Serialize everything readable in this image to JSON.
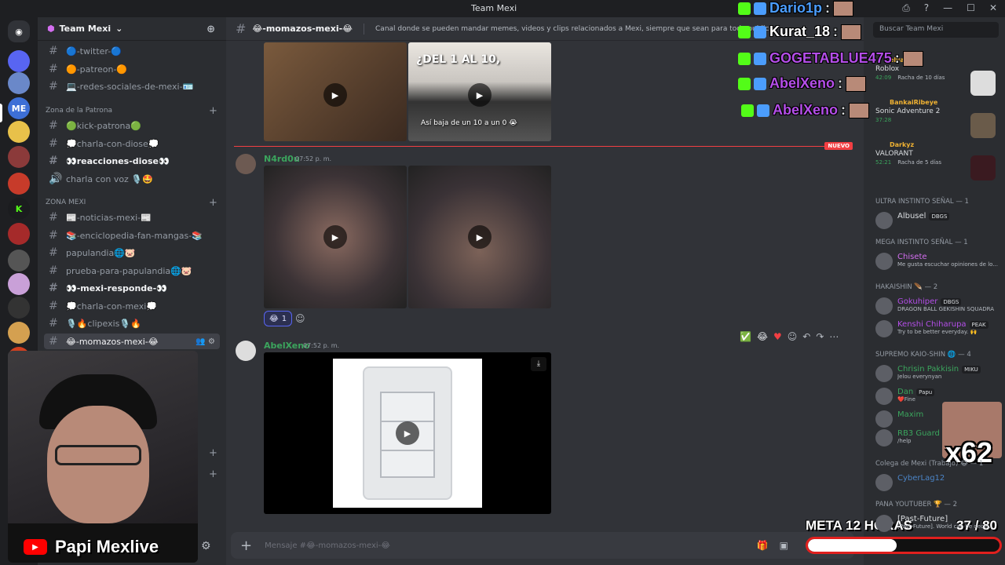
{
  "window": {
    "title": "Team Mexi",
    "controls": [
      "—",
      "☐",
      "✕"
    ]
  },
  "servers": [
    {
      "label": "",
      "color": "#5865f2"
    },
    {
      "label": "",
      "color": "#6a88c9"
    },
    {
      "label": "ME",
      "color": "#3d6fd6"
    },
    {
      "label": "",
      "color": "#e8c14a"
    },
    {
      "label": "",
      "color": "#8b3a3a"
    },
    {
      "label": "",
      "color": "#c73b2a"
    },
    {
      "label": "K",
      "color": "#1b1c1f"
    },
    {
      "label": "",
      "color": "#a52a2a"
    },
    {
      "label": "",
      "color": "#555"
    },
    {
      "label": "",
      "color": "#c9a0d8"
    },
    {
      "label": "",
      "color": "#333"
    },
    {
      "label": "",
      "color": "#d4a050"
    },
    {
      "label": "",
      "color": "#d04020"
    }
  ],
  "guild": {
    "name": "Team Mexi"
  },
  "channels_top": [
    {
      "name": "🔵-twitter-🔵",
      "unread": false
    },
    {
      "name": "🟠-patreon-🟠",
      "unread": false
    },
    {
      "name": "💻-redes-sociales-de-mexi-🪪",
      "unread": false
    }
  ],
  "category1": "Zona de la Patrona",
  "channels_cat1": [
    {
      "name": "🟢kick-patrona🟢",
      "unread": false,
      "icon": "#"
    },
    {
      "name": "💭charla-con-diose💭",
      "unread": false,
      "icon": "#"
    },
    {
      "name": "👀reacciones-diose👀",
      "unread": true,
      "icon": "#"
    },
    {
      "name": "charla con voz 🎙️🤩",
      "unread": false,
      "icon": "🔊"
    }
  ],
  "category2": "ZONA MEXI",
  "channels_cat2": [
    {
      "name": "📰-noticias-mexi-📰",
      "unread": false
    },
    {
      "name": "📚-enciclopedia-fan-mangas-📚",
      "unread": false
    },
    {
      "name": "papulandia🌐🐷",
      "unread": false
    },
    {
      "name": "prueba-para-papulandia🌐🐷",
      "unread": false
    },
    {
      "name": "👀-mexi-responde-👀",
      "unread": true
    },
    {
      "name": "💭charla-con-mexi💭",
      "unread": false
    },
    {
      "name": "🎙️🔥clipexis🎙️🔥",
      "unread": false
    },
    {
      "name": "😂-momazos-mexi-😂",
      "unread": false,
      "active": true
    }
  ],
  "stream": {
    "name": "Papi Mexlive"
  },
  "chat": {
    "channel": "😂-momazos-mexi-😂",
    "topic": "Canal donde se pueden mandar memes, videos y clips relacionados a Mexi, siempre que sean para todo publico.",
    "media_text_top": "¿DEL 1 AL 10,",
    "media_text_bottom": "Así baja de un 10 a un 0 😭",
    "new_label": "NUEVO",
    "messages": [
      {
        "author": "N4rd0u",
        "time": "07:52 p. m."
      },
      {
        "author": "AbelXeno",
        "time": "07:52 p. m."
      }
    ],
    "reaction": {
      "emoji": "😂",
      "count": "1"
    },
    "composer_placeholder": "Mensaje #😂-momazos-mexi-😂"
  },
  "members": {
    "search_placeholder": "Buscar Team Mexi",
    "activities": [
      {
        "name": "elvato",
        "game": "Roblox",
        "time": "42:09",
        "streak": "Racha de 10 días"
      },
      {
        "name": "BankaiRibeye",
        "game": "Sonic Adventure 2",
        "time": "37:28",
        "streak": ""
      },
      {
        "name": "Darkyz",
        "game": "VALORANT",
        "time": "52:21",
        "streak": "Racha de 5 días"
      }
    ],
    "groups": [
      {
        "title": "ULTRA INSTINTO SEÑAL — 1",
        "items": [
          {
            "name": "Albusel",
            "sub": "",
            "tag": "DBGS",
            "color": "#dbdee1"
          }
        ]
      },
      {
        "title": "MEGA INSTINTO SEÑAL — 1",
        "items": [
          {
            "name": "Chisete",
            "sub": "Me gusta escuchar opiniones de lo...",
            "tag": "",
            "color": "#d36ef0"
          }
        ]
      },
      {
        "title": "HAKAISHIN 🪶 — 2",
        "items": [
          {
            "name": "Gokuhiper",
            "sub": "DRAGON BALL GEKISHIN SQUADRA",
            "tag": "DBGS",
            "color": "#b44ee8"
          },
          {
            "name": "Kenshi Chiharupa",
            "sub": "Try to be better everyday. 🙌",
            "tag": "PEAK",
            "color": "#b44ee8"
          }
        ]
      },
      {
        "title": "SUPREMO KAIO-SHIN 🌐 — 4",
        "items": [
          {
            "name": "Chrisin Pakkisin",
            "sub": "Jelou everynyan",
            "tag": "MIKU",
            "color": "#3ba55d"
          },
          {
            "name": "Dan",
            "sub": "❤️Fine",
            "tag": "Papu",
            "color": "#3ba55d"
          },
          {
            "name": "Maxim",
            "sub": "",
            "tag": "",
            "color": "#3ba55d"
          },
          {
            "name": "RB3 Guard",
            "sub": "/help",
            "tag": "",
            "color": "#3ba55d"
          }
        ]
      },
      {
        "title": "Colega de Mexi (Trabajo) 😂 — 1",
        "items": [
          {
            "name": "CyberLag12",
            "sub": "",
            "tag": "",
            "color": "#4b84c6"
          }
        ]
      },
      {
        "title": "PANA YOUTUBER 🏆 — 2",
        "items": [
          {
            "name": "[Past-Future]",
            "sub": "[Past-Future]. World can be decei...",
            "tag": "",
            "color": "#dbdee1"
          }
        ]
      }
    ]
  },
  "overlay": {
    "names": [
      {
        "name": "Dario1p",
        "color": "#4b9dfd"
      },
      {
        "name": "Kurat_18",
        "color": "#ffffff"
      },
      {
        "name": "GOGETABLUE475",
        "color": "#b44ee8"
      },
      {
        "name": "AbelXeno",
        "color": "#b44ee8"
      },
      {
        "name": "AbelXeno",
        "color": "#b44ee8"
      }
    ],
    "multiplier": "x62",
    "goal_label": "META 12 HORAS",
    "goal_current": "37",
    "goal_sep": " / ",
    "goal_total": "80",
    "goal_progress": 0.4625
  }
}
